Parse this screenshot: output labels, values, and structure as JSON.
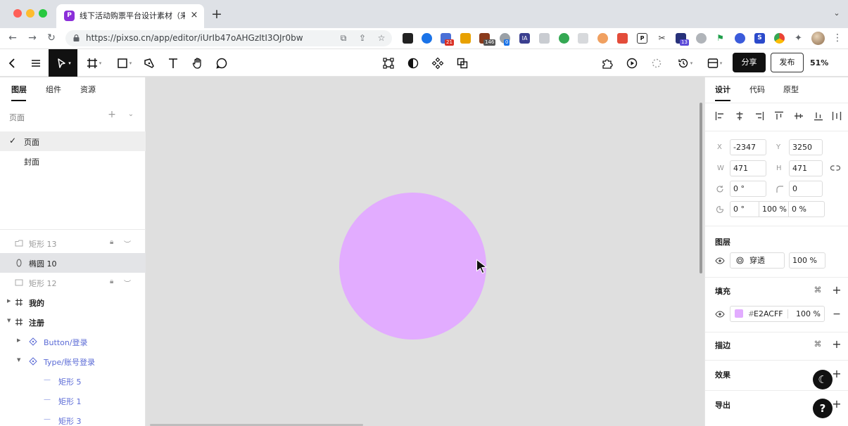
{
  "browser": {
    "tab_title": "线下活动购票平台设计素材（来自",
    "tab_close": "×",
    "new_tab": "+",
    "url": "https://pixso.cn/app/editor/iUrIb47oAHGzItI3OJr0bw",
    "ext_badges": [
      "21",
      "146",
      "0",
      "13"
    ],
    "ext_ia": "IA",
    "ext_p": "P",
    "ext_s": "S"
  },
  "toolbar": {
    "share_label": "分享",
    "publish_label": "发布",
    "zoom": "51%"
  },
  "left_panel": {
    "tabs": [
      "图层",
      "组件",
      "资源"
    ],
    "pages_label": "页面",
    "pages": [
      {
        "name": "页面",
        "selected": true
      },
      {
        "name": "封面",
        "selected": false
      }
    ],
    "layers": [
      {
        "name": "矩形 13",
        "kind": "rect-dim",
        "locked": true,
        "hidden": true
      },
      {
        "name": "椭圆 10",
        "kind": "ellipse",
        "selected": true
      },
      {
        "name": "矩形 12",
        "kind": "rect-dim",
        "locked": true,
        "hidden": true
      },
      {
        "name": "我的",
        "kind": "frame"
      },
      {
        "name": "注册",
        "kind": "frame",
        "expanded": true
      },
      {
        "name": "Button/登录",
        "kind": "component"
      },
      {
        "name": "Type/账号登录",
        "kind": "component",
        "expanded": true
      },
      {
        "name": "矩形 5",
        "kind": "component-child"
      },
      {
        "name": "矩形 1",
        "kind": "component-child"
      },
      {
        "name": "矩形 3",
        "kind": "component-child"
      }
    ]
  },
  "canvas": {
    "ellipse_fill": "#E2ACFF"
  },
  "right_panel": {
    "tabs": [
      "设计",
      "代码",
      "原型"
    ],
    "x_label": "X",
    "x": "-2347",
    "y_label": "Y",
    "y": "3250",
    "w_label": "W",
    "w": "471",
    "h_label": "H",
    "h": "471",
    "rotation": "0 °",
    "radius": "0",
    "arc_start": "0 °",
    "arc_sweep": "100 %",
    "arc_ratio": "0 %",
    "layer_head": "图层",
    "blend_mode": "穿透",
    "layer_opacity": "100 %",
    "fill_head": "填充",
    "fill_hex": "E2ACFF",
    "fill_hash": "#",
    "fill_opacity": "100 %",
    "stroke_head": "描边",
    "effect_head": "效果",
    "export_head": "导出",
    "help": "?"
  }
}
